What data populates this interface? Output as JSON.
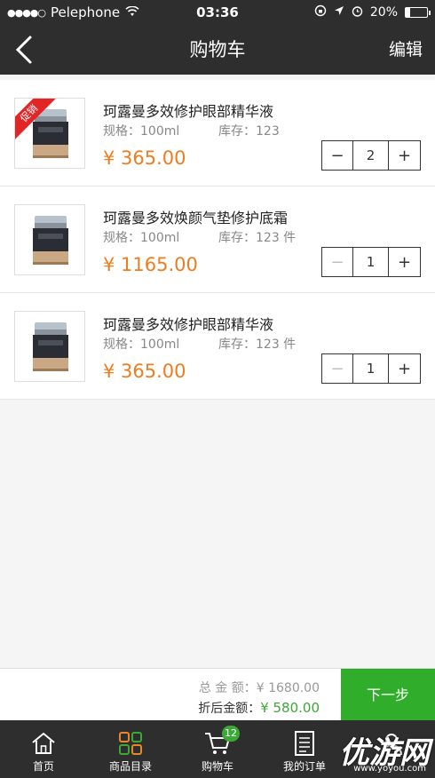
{
  "status_bar": {
    "carrier": "Pelephone",
    "time": "03:36",
    "battery_percent": "20%",
    "battery_level": 0.2
  },
  "nav": {
    "title": "购物车",
    "edit_label": "编辑"
  },
  "items": [
    {
      "name": "珂露曼多效修护眼部精华液",
      "spec": "规格：100ml",
      "stock": "库存：123",
      "price": "¥ 365.00",
      "quantity": "2",
      "promo": "促销",
      "has_promo": true,
      "minus_enabled": true
    },
    {
      "name": "珂露曼多效焕颜气垫修护底霜",
      "spec": "规格：100ml",
      "stock": "库存：123 件",
      "price": "¥ 1165.00",
      "quantity": "1",
      "has_promo": false,
      "minus_enabled": false
    },
    {
      "name": "珂露曼多效修护眼部精华液",
      "spec": "规格：100ml",
      "stock": "库存：123 件",
      "price": "¥ 365.00",
      "quantity": "1",
      "has_promo": false,
      "minus_enabled": false
    }
  ],
  "checkout": {
    "total_label": "总 金 额：",
    "total_amount": "¥ 1680.00",
    "discount_label": "折后金额：",
    "discount_amount": "¥ 580.00",
    "next_label": "下一步"
  },
  "tabs": [
    {
      "label": "首页",
      "icon": "home-icon"
    },
    {
      "label": "商品目录",
      "icon": "grid-icon"
    },
    {
      "label": "购物车",
      "icon": "cart-icon",
      "badge": "12"
    },
    {
      "label": "我的订单",
      "icon": "orders-icon"
    },
    {
      "label": "",
      "icon": "user-icon"
    }
  ],
  "watermark": {
    "text": "优游网",
    "sub": "www.yoyou.com"
  },
  "colors": {
    "bar_bg": "#2e2e2e",
    "price": "#f07c1f",
    "accent_green": "#2fad2b",
    "promo_red": "#e32525"
  }
}
